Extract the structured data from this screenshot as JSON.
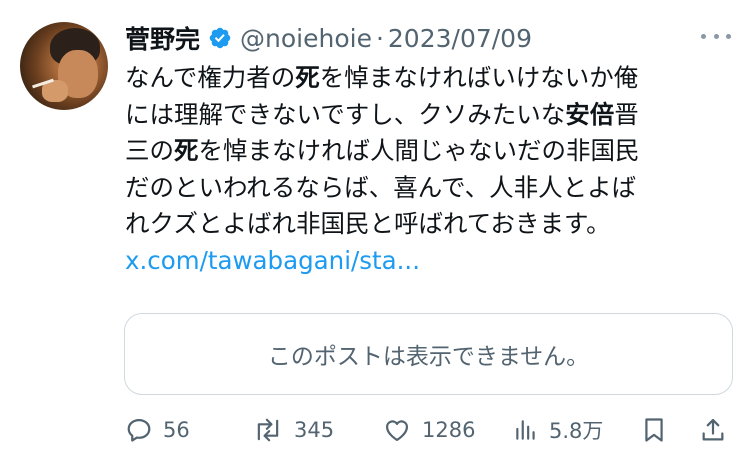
{
  "author": {
    "display_name": "菅野完",
    "handle": "@noiehoie",
    "separator": "·",
    "date": "2023/07/09"
  },
  "icons": {
    "verified": "verified-badge-icon",
    "more": "more-dots-icon",
    "reply": "reply-icon",
    "repost": "repost-icon",
    "like": "like-icon",
    "views": "views-icon",
    "bookmark": "bookmark-icon",
    "share": "share-icon"
  },
  "colors": {
    "accent": "#1d9bf0",
    "text": "#0f1419",
    "muted": "#536471",
    "border": "#cfd9de"
  },
  "tweet": {
    "lines": [
      [
        {
          "t": "なんで権力者の",
          "b": false
        },
        {
          "t": "死",
          "b": true
        },
        {
          "t": "を悼まなければいけないか俺",
          "b": false
        }
      ],
      [
        {
          "t": "には理解できないですし、クソみたいな",
          "b": false
        },
        {
          "t": "安倍",
          "b": true
        },
        {
          "t": "晋",
          "b": false
        }
      ],
      [
        {
          "t": "三の",
          "b": false
        },
        {
          "t": "死",
          "b": true
        },
        {
          "t": "を悼まなければ人間じゃないだの非国民",
          "b": false
        }
      ],
      [
        {
          "t": "だのといわれるならば、喜んで、人非人とよば",
          "b": false
        }
      ],
      [
        {
          "t": "れクズとよばれ非国民と呼ばれておきます。",
          "b": false
        }
      ]
    ],
    "link": "x.com/tawabagani/sta..."
  },
  "quote": {
    "unavailable_text": "このポストは表示できません。"
  },
  "stats": {
    "replies": "56",
    "reposts": "345",
    "likes": "1286",
    "views": "5.8万"
  }
}
